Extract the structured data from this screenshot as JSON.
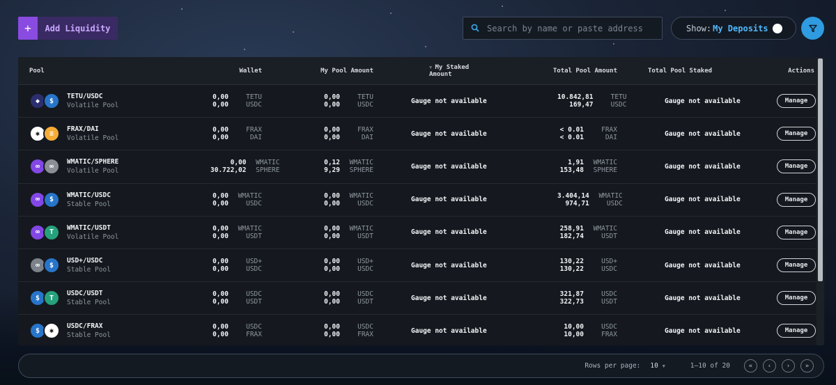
{
  "toolbar": {
    "add_icon": "+",
    "add_label": "Add Liquidity",
    "search_placeholder": "Search by name or paste address",
    "show_label": "Show:",
    "show_value": "My Deposits"
  },
  "table": {
    "headers": {
      "pool": "Pool",
      "wallet": "Wallet",
      "my_pool": "My Pool Amount",
      "my_staked": "My Staked Amount",
      "total_pool": "Total Pool Amount",
      "total_staked": "Total Pool Staked",
      "actions": "Actions"
    },
    "rows": [
      {
        "name": "TETU/USDC",
        "type": "Volatile Pool",
        "icon_a": "tetu-icon",
        "icon_b": "usdc-icon",
        "wallet": [
          [
            "0,00",
            "TETU"
          ],
          [
            "0,00",
            "USDC"
          ]
        ],
        "my_pool": [
          [
            "0,00",
            "TETU"
          ],
          [
            "0,00",
            "USDC"
          ]
        ],
        "my_staked": "Gauge not available",
        "total_pool": [
          [
            "10.842,81",
            "TETU"
          ],
          [
            "169,47",
            "USDC"
          ]
        ],
        "total_staked": "Gauge not available",
        "action": "Manage"
      },
      {
        "name": "FRAX/DAI",
        "type": "Volatile Pool",
        "icon_a": "frax-icon",
        "icon_b": "dai-icon",
        "wallet": [
          [
            "0,00",
            "FRAX"
          ],
          [
            "0,00",
            "DAI"
          ]
        ],
        "my_pool": [
          [
            "0,00",
            "FRAX"
          ],
          [
            "0,00",
            "DAI"
          ]
        ],
        "my_staked": "Gauge not available",
        "total_pool": [
          [
            "< 0.01",
            "FRAX"
          ],
          [
            "< 0.01",
            "DAI"
          ]
        ],
        "total_staked": "Gauge not available",
        "action": "Manage"
      },
      {
        "name": "WMATIC/SPHERE",
        "type": "Volatile Pool",
        "icon_a": "wmatic-icon",
        "icon_b": "sphere-icon",
        "wallet": [
          [
            "0,00",
            "WMATIC"
          ],
          [
            "30.722,02",
            "SPHERE"
          ]
        ],
        "my_pool": [
          [
            "0,12",
            "WMATIC"
          ],
          [
            "9,29",
            "SPHERE"
          ]
        ],
        "my_staked": "Gauge not available",
        "total_pool": [
          [
            "1,91",
            "WMATIC"
          ],
          [
            "153,48",
            "SPHERE"
          ]
        ],
        "total_staked": "Gauge not available",
        "action": "Manage"
      },
      {
        "name": "WMATIC/USDC",
        "type": "Stable Pool",
        "icon_a": "wmatic-icon",
        "icon_b": "usdc-icon",
        "wallet": [
          [
            "0,00",
            "WMATIC"
          ],
          [
            "0,00",
            "USDC"
          ]
        ],
        "my_pool": [
          [
            "0,00",
            "WMATIC"
          ],
          [
            "0,00",
            "USDC"
          ]
        ],
        "my_staked": "Gauge not available",
        "total_pool": [
          [
            "3.404,14",
            "WMATIC"
          ],
          [
            "974,71",
            "USDC"
          ]
        ],
        "total_staked": "Gauge not available",
        "action": "Manage"
      },
      {
        "name": "WMATIC/USDT",
        "type": "Volatile Pool",
        "icon_a": "wmatic-icon",
        "icon_b": "usdt-icon",
        "wallet": [
          [
            "0,00",
            "WMATIC"
          ],
          [
            "0,00",
            "USDT"
          ]
        ],
        "my_pool": [
          [
            "0,00",
            "WMATIC"
          ],
          [
            "0,00",
            "USDT"
          ]
        ],
        "my_staked": "Gauge not available",
        "total_pool": [
          [
            "258,91",
            "WMATIC"
          ],
          [
            "182,74",
            "USDT"
          ]
        ],
        "total_staked": "Gauge not available",
        "action": "Manage"
      },
      {
        "name": "USD+/USDC",
        "type": "Stable Pool",
        "icon_a": "usdplus-icon",
        "icon_b": "usdc-icon",
        "wallet": [
          [
            "0,00",
            "USD+"
          ],
          [
            "0,00",
            "USDC"
          ]
        ],
        "my_pool": [
          [
            "0,00",
            "USD+"
          ],
          [
            "0,00",
            "USDC"
          ]
        ],
        "my_staked": "Gauge not available",
        "total_pool": [
          [
            "130,22",
            "USD+"
          ],
          [
            "130,22",
            "USDC"
          ]
        ],
        "total_staked": "Gauge not available",
        "action": "Manage"
      },
      {
        "name": "USDC/USDT",
        "type": "Stable Pool",
        "icon_a": "usdc-icon",
        "icon_b": "usdt-icon",
        "wallet": [
          [
            "0,00",
            "USDC"
          ],
          [
            "0,00",
            "USDT"
          ]
        ],
        "my_pool": [
          [
            "0,00",
            "USDC"
          ],
          [
            "0,00",
            "USDT"
          ]
        ],
        "my_staked": "Gauge not available",
        "total_pool": [
          [
            "321,87",
            "USDC"
          ],
          [
            "322,73",
            "USDT"
          ]
        ],
        "total_staked": "Gauge not available",
        "action": "Manage"
      },
      {
        "name": "USDC/FRAX",
        "type": "Stable Pool",
        "icon_a": "usdc-icon",
        "icon_b": "frax-icon",
        "wallet": [
          [
            "0,00",
            "USDC"
          ],
          [
            "0,00",
            "FRAX"
          ]
        ],
        "my_pool": [
          [
            "0,00",
            "USDC"
          ],
          [
            "0,00",
            "FRAX"
          ]
        ],
        "my_staked": "Gauge not available",
        "total_pool": [
          [
            "10,00",
            "USDC"
          ],
          [
            "10,00",
            "FRAX"
          ]
        ],
        "total_staked": "Gauge not available",
        "action": "Manage"
      }
    ]
  },
  "footer": {
    "rows_per_page_label": "Rows per page:",
    "rows_per_page_value": "10",
    "range": "1–10 of 20"
  },
  "colors": {
    "accent": "#8a4be0",
    "link": "#4fb8ff",
    "tetu": "#2b2f6e",
    "usdc": "#2775ca",
    "dai": "#f5ac37",
    "frax": "#ffffff",
    "wmatic": "#8247e5",
    "sphere": "#8a8f96",
    "usdt": "#26a17b",
    "usdplus": "#7c828a"
  }
}
